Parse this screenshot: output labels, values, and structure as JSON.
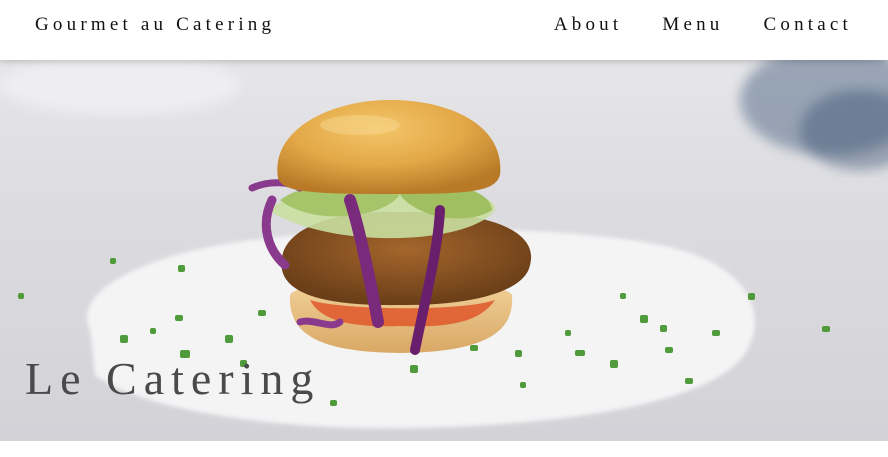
{
  "header": {
    "brand": "Gourmet au Catering",
    "nav": [
      {
        "label": "About"
      },
      {
        "label": "Menu"
      },
      {
        "label": "Contact"
      }
    ]
  },
  "hero": {
    "title": "Le Catering",
    "image_subject": "burger-photo"
  },
  "colors": {
    "header_bg": "#ffffff",
    "text": "#111111",
    "hero_title": "#4a4a4a"
  }
}
